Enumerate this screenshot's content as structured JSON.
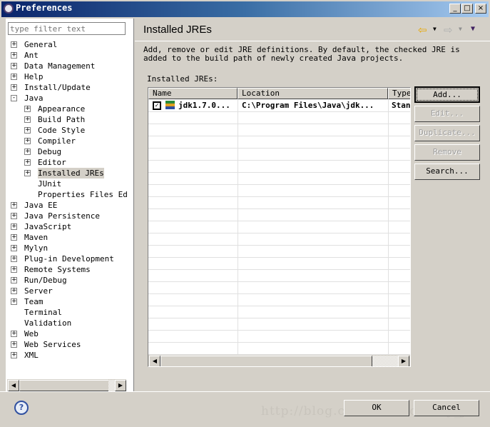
{
  "window": {
    "title": "Preferences",
    "minimize": "_",
    "maximize": "□",
    "close": "×"
  },
  "filter": {
    "placeholder": "type filter text"
  },
  "tree": [
    {
      "label": "General",
      "level": 0,
      "expander": "+"
    },
    {
      "label": "Ant",
      "level": 0,
      "expander": "+"
    },
    {
      "label": "Data Management",
      "level": 0,
      "expander": "+"
    },
    {
      "label": "Help",
      "level": 0,
      "expander": "+"
    },
    {
      "label": "Install/Update",
      "level": 0,
      "expander": "+"
    },
    {
      "label": "Java",
      "level": 0,
      "expander": "-"
    },
    {
      "label": "Appearance",
      "level": 1,
      "expander": "+"
    },
    {
      "label": "Build Path",
      "level": 1,
      "expander": "+"
    },
    {
      "label": "Code Style",
      "level": 1,
      "expander": "+"
    },
    {
      "label": "Compiler",
      "level": 1,
      "expander": "+"
    },
    {
      "label": "Debug",
      "level": 1,
      "expander": "+"
    },
    {
      "label": "Editor",
      "level": 1,
      "expander": "+"
    },
    {
      "label": "Installed JREs",
      "level": 1,
      "expander": "+",
      "selected": true
    },
    {
      "label": "JUnit",
      "level": 1,
      "expander": ""
    },
    {
      "label": "Properties Files Edit",
      "level": 1,
      "expander": ""
    },
    {
      "label": "Java EE",
      "level": 0,
      "expander": "+"
    },
    {
      "label": "Java Persistence",
      "level": 0,
      "expander": "+"
    },
    {
      "label": "JavaScript",
      "level": 0,
      "expander": "+"
    },
    {
      "label": "Maven",
      "level": 0,
      "expander": "+"
    },
    {
      "label": "Mylyn",
      "level": 0,
      "expander": "+"
    },
    {
      "label": "Plug-in Development",
      "level": 0,
      "expander": "+"
    },
    {
      "label": "Remote Systems",
      "level": 0,
      "expander": "+"
    },
    {
      "label": "Run/Debug",
      "level": 0,
      "expander": "+"
    },
    {
      "label": "Server",
      "level": 0,
      "expander": "+"
    },
    {
      "label": "Team",
      "level": 0,
      "expander": "+"
    },
    {
      "label": "Terminal",
      "level": 0,
      "expander": ""
    },
    {
      "label": "Validation",
      "level": 0,
      "expander": ""
    },
    {
      "label": "Web",
      "level": 0,
      "expander": "+"
    },
    {
      "label": "Web Services",
      "level": 0,
      "expander": "+"
    },
    {
      "label": "XML",
      "level": 0,
      "expander": "+"
    }
  ],
  "page": {
    "title": "Installed JREs",
    "description": "Add, remove or edit JRE definitions. By default, the checked JRE is added to the build path of newly created Java projects.",
    "table_label": "Installed JREs:",
    "columns": [
      "Name",
      "Location",
      "Type"
    ],
    "rows": [
      {
        "checked": true,
        "name": "jdk1.7.0...",
        "location": "C:\\Program Files\\Java\\jdk...",
        "type": "Stan"
      }
    ],
    "buttons": [
      {
        "label": "Add...",
        "enabled": true
      },
      {
        "label": "Edit...",
        "enabled": false
      },
      {
        "label": "Duplicate...",
        "enabled": false
      },
      {
        "label": "Remove",
        "enabled": false
      },
      {
        "label": "Search...",
        "enabled": true
      }
    ]
  },
  "footer": {
    "ok": "OK",
    "cancel": "Cancel"
  },
  "watermark": "http://blog.csdn.net/Solitary_J"
}
